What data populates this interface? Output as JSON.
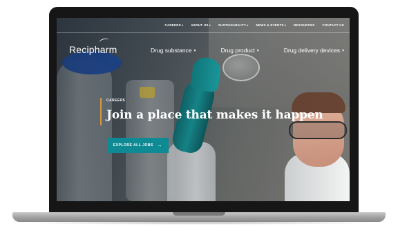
{
  "util_nav": [
    {
      "label": "CAREERS",
      "has_dropdown": true
    },
    {
      "label": "ABOUT US",
      "has_dropdown": true
    },
    {
      "label": "SUSTAINABILITY",
      "has_dropdown": true
    },
    {
      "label": "NEWS & EVENTS",
      "has_dropdown": true
    },
    {
      "label": "RESOURCES",
      "has_dropdown": false
    },
    {
      "label": "CONTACT US",
      "has_dropdown": false
    }
  ],
  "logo": {
    "text": "Recipharm"
  },
  "main_nav": [
    {
      "label": "Drug substance",
      "has_dropdown": true
    },
    {
      "label": "Drug product",
      "has_dropdown": true
    },
    {
      "label": "Drug delivery devices",
      "has_dropdown": true
    }
  ],
  "hero": {
    "eyebrow": "CAREERS",
    "title": "Join a place that makes it happen",
    "cta_label": "EXPLORE ALL JOBS",
    "cta_icon": "arrow-right-icon"
  },
  "colors": {
    "accent": "#0d8a93",
    "eyebrow_bar": "#d79a3d",
    "glove": "#16979a"
  },
  "icons": {
    "dropdown": "chevron-down-icon",
    "cta": "arrow-right-icon"
  }
}
